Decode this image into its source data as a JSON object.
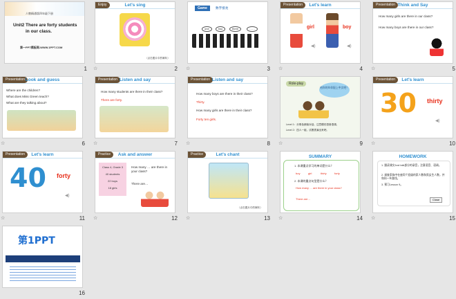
{
  "slides": [
    {
      "num": "1",
      "lines": [
        "人教精通版四年级下册",
        "Unit2 There are forty students",
        "in our class.",
        "第一PPT模板网-WWW.1PPT.COM"
      ]
    },
    {
      "num": "2",
      "tag": "Enjoy",
      "title": "Let's sing",
      "caption": "（点击图片中的喇叭）"
    },
    {
      "num": "3",
      "game_label": "Game",
      "game_title": "数字接龙",
      "bubbles": [
        "one",
        "two",
        "three",
        "……"
      ]
    },
    {
      "num": "4",
      "tag": "Presentation",
      "title": "Let's learn",
      "girl": "girl",
      "boy": "boy"
    },
    {
      "num": "5",
      "tag": "Presentation",
      "title": "Think and Say",
      "q1": "How many girls are there in our class?",
      "q2": "How many boys are there in our class?"
    },
    {
      "num": "6",
      "tag": "Presentation",
      "title": "Look and guess",
      "q1": "Where are the children?",
      "q2": "What does Miss Green teach?",
      "q3": "What are they talking about?"
    },
    {
      "num": "7",
      "tag": "Presentation",
      "title": "Listen and say",
      "q1": "How many students are there in their class?",
      "a1": "There are forty."
    },
    {
      "num": "8",
      "tag": "Presentation",
      "title": "Listen and say",
      "q1": "How many boys are there in their class?",
      "a1": "Thirty.",
      "q2": "How many girls are there in their class?",
      "a2": "Forty ten girls."
    },
    {
      "num": "9",
      "roleplay": "Role-play",
      "burst": "给你的伙伴配上中文吧！",
      "level1": "Level 1：分角色朗读对话，注意模仿语音语调。",
      "level2": "Level 2：四人一组，试着表演出来吧。"
    },
    {
      "num": "10",
      "tag": "Presentation",
      "title": "Let's learn",
      "big": "30",
      "word": "thirty"
    },
    {
      "num": "11",
      "tag": "Presentation",
      "title": "Let's learn",
      "big": "40",
      "word": "forty"
    },
    {
      "num": "12",
      "tag": "Practice",
      "title": "Ask and answer",
      "card": [
        "Class 4, Grade 3",
        "40 students",
        "22 boys",
        "18 girls"
      ],
      "q": "How many … are there in your class?",
      "a": "There are…"
    },
    {
      "num": "13",
      "tag": "Practice",
      "title": "Let's chant",
      "caption": "（点击图片中的喇叭）"
    },
    {
      "num": "14",
      "title": "SUMMARY",
      "q1": "1. 本课重点学习的单词是什么？",
      "words": [
        "boy",
        "girl",
        "thirty",
        "forty"
      ],
      "q2": "2. 本课的重点句型是什么？",
      "s1": "How many … are there in your class?",
      "s2": "There are…"
    },
    {
      "num": "15",
      "title": "HOMEWORK",
      "items": [
        "1. 跟读课文Just talk部分的录音，注意语音、语调。",
        "2. 调查家族中在座同个班级的家人数和男女生人数，并和同一伙查找。",
        "3. 预习Lesson 9。"
      ],
      "close": "Close"
    },
    {
      "num": "16",
      "logo": "第1PPT"
    }
  ],
  "star": "☆"
}
